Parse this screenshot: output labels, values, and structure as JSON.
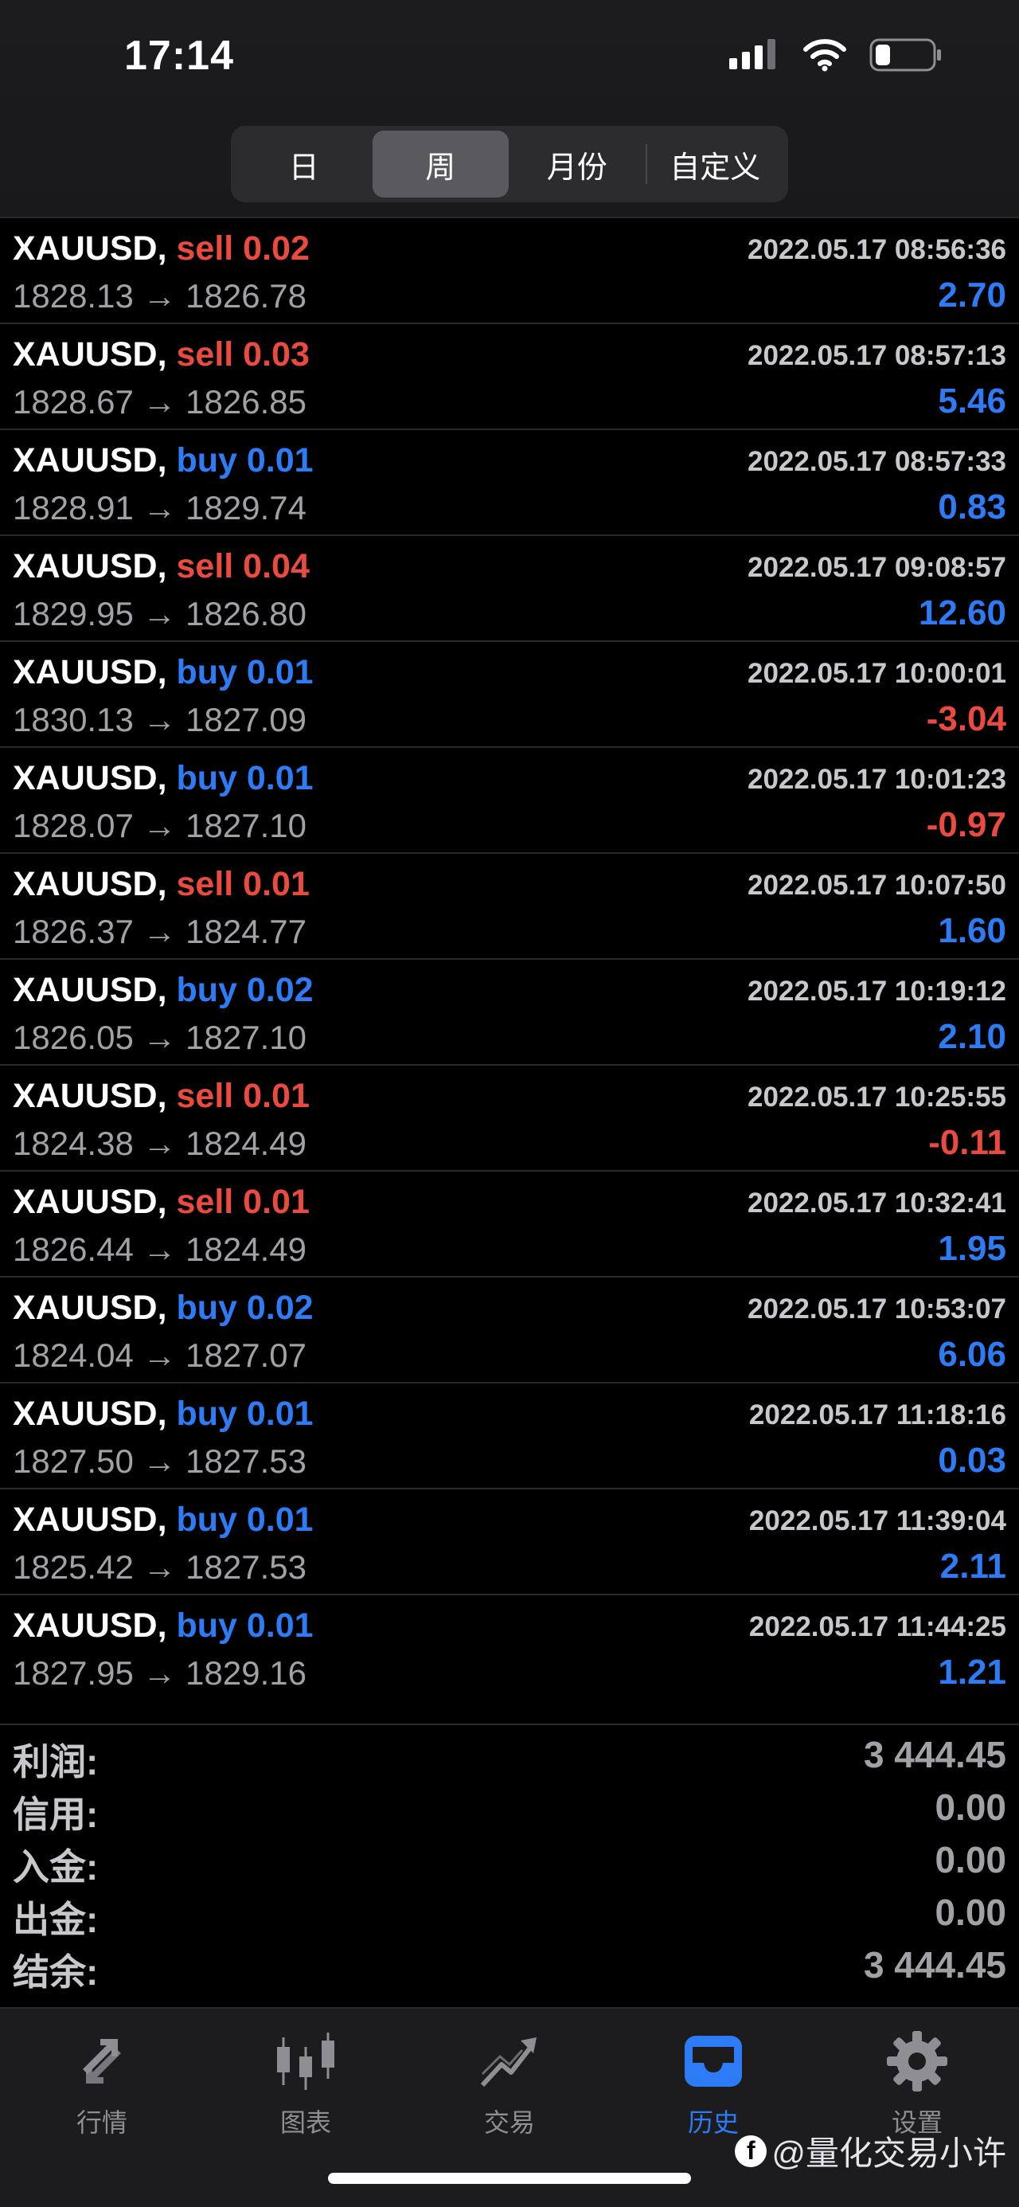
{
  "status_bar": {
    "time": "17:14"
  },
  "period_tabs": [
    {
      "label": "日",
      "active": false
    },
    {
      "label": "周",
      "active": true
    },
    {
      "label": "月份",
      "active": false
    },
    {
      "label": "自定义",
      "active": false
    }
  ],
  "deals": [
    {
      "symbol": "XAUUSD,",
      "side": "sell",
      "volume": "0.02",
      "time": "2022.05.17 08:56:36",
      "prices": "1828.13 → 1826.78",
      "profit": "2.70"
    },
    {
      "symbol": "XAUUSD,",
      "side": "sell",
      "volume": "0.03",
      "time": "2022.05.17 08:57:13",
      "prices": "1828.67 → 1826.85",
      "profit": "5.46"
    },
    {
      "symbol": "XAUUSD,",
      "side": "buy",
      "volume": "0.01",
      "time": "2022.05.17 08:57:33",
      "prices": "1828.91 → 1829.74",
      "profit": "0.83"
    },
    {
      "symbol": "XAUUSD,",
      "side": "sell",
      "volume": "0.04",
      "time": "2022.05.17 09:08:57",
      "prices": "1829.95 → 1826.80",
      "profit": "12.60"
    },
    {
      "symbol": "XAUUSD,",
      "side": "buy",
      "volume": "0.01",
      "time": "2022.05.17 10:00:01",
      "prices": "1830.13 → 1827.09",
      "profit": "-3.04"
    },
    {
      "symbol": "XAUUSD,",
      "side": "buy",
      "volume": "0.01",
      "time": "2022.05.17 10:01:23",
      "prices": "1828.07 → 1827.10",
      "profit": "-0.97"
    },
    {
      "symbol": "XAUUSD,",
      "side": "sell",
      "volume": "0.01",
      "time": "2022.05.17 10:07:50",
      "prices": "1826.37 → 1824.77",
      "profit": "1.60"
    },
    {
      "symbol": "XAUUSD,",
      "side": "buy",
      "volume": "0.02",
      "time": "2022.05.17 10:19:12",
      "prices": "1826.05 → 1827.10",
      "profit": "2.10"
    },
    {
      "symbol": "XAUUSD,",
      "side": "sell",
      "volume": "0.01",
      "time": "2022.05.17 10:25:55",
      "prices": "1824.38 → 1824.49",
      "profit": "-0.11"
    },
    {
      "symbol": "XAUUSD,",
      "side": "sell",
      "volume": "0.01",
      "time": "2022.05.17 10:32:41",
      "prices": "1826.44 → 1824.49",
      "profit": "1.95"
    },
    {
      "symbol": "XAUUSD,",
      "side": "buy",
      "volume": "0.02",
      "time": "2022.05.17 10:53:07",
      "prices": "1824.04 → 1827.07",
      "profit": "6.06"
    },
    {
      "symbol": "XAUUSD,",
      "side": "buy",
      "volume": "0.01",
      "time": "2022.05.17 11:18:16",
      "prices": "1827.50 → 1827.53",
      "profit": "0.03"
    },
    {
      "symbol": "XAUUSD,",
      "side": "buy",
      "volume": "0.01",
      "time": "2022.05.17 11:39:04",
      "prices": "1825.42 → 1827.53",
      "profit": "2.11"
    },
    {
      "symbol": "XAUUSD,",
      "side": "buy",
      "volume": "0.01",
      "time": "2022.05.17 11:44:25",
      "prices": "1827.95 → 1829.16",
      "profit": "1.21"
    }
  ],
  "summary": [
    {
      "label": "利润:",
      "value": "3 444.45"
    },
    {
      "label": "信用:",
      "value": "0.00"
    },
    {
      "label": "入金:",
      "value": "0.00"
    },
    {
      "label": "出金:",
      "value": "0.00"
    },
    {
      "label": "结余:",
      "value": "3 444.45"
    }
  ],
  "tabbar": [
    {
      "label": "行情",
      "icon": "quotes-arrows-icon",
      "active": false
    },
    {
      "label": "图表",
      "icon": "candlestick-chart-icon",
      "active": false
    },
    {
      "label": "交易",
      "icon": "trade-trend-icon",
      "active": false
    },
    {
      "label": "历史",
      "icon": "history-inbox-icon",
      "active": true
    },
    {
      "label": "设置",
      "icon": "gear-icon",
      "active": false
    }
  ],
  "watermark": "@量化交易小许",
  "colors": {
    "sell": "#ea4a3f",
    "buy": "#2d7cf6",
    "positive": "#2d7cf6",
    "negative": "#ea4a3f",
    "active_tab": "#2d7cf6"
  }
}
